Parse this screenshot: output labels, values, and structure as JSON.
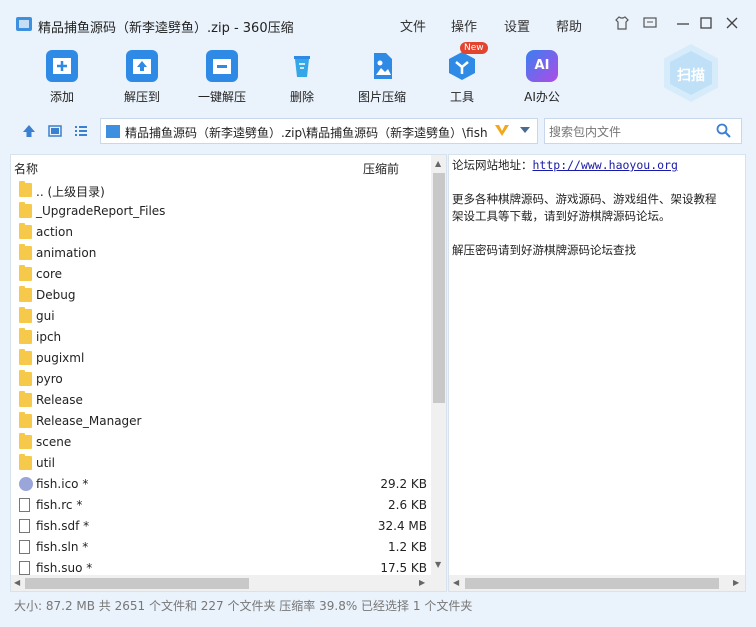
{
  "window": {
    "title": "精品捕鱼源码（新李逵劈鱼）.zip - 360压缩",
    "menu": [
      "文件",
      "操作",
      "设置",
      "帮助"
    ]
  },
  "toolbar": {
    "tools": [
      {
        "label": "添加",
        "icon": "add-icon"
      },
      {
        "label": "解压到",
        "icon": "extract-to-icon"
      },
      {
        "label": "一键解压",
        "icon": "one-click-extract-icon"
      },
      {
        "label": "删除",
        "icon": "delete-icon"
      },
      {
        "label": "图片压缩",
        "icon": "image-compress-icon"
      },
      {
        "label": "工具",
        "icon": "tools-icon"
      },
      {
        "label": "AI办公",
        "icon": "ai-office-icon"
      }
    ],
    "new_badge": "New",
    "scan_label": "扫描",
    "ai_text": "AI"
  },
  "address": {
    "path": "精品捕鱼源码（新李逵劈鱼）.zip\\精品捕鱼源码（新李逵劈鱼）\\fish",
    "search_placeholder": "搜索包内文件"
  },
  "list": {
    "col_name": "名称",
    "col_size": "压缩前",
    "rows": [
      {
        "name": ".. (上级目录)",
        "size": "",
        "type": "folder"
      },
      {
        "name": "_UpgradeReport_Files",
        "size": "",
        "type": "folder"
      },
      {
        "name": "action",
        "size": "",
        "type": "folder"
      },
      {
        "name": "animation",
        "size": "",
        "type": "folder"
      },
      {
        "name": "core",
        "size": "",
        "type": "folder"
      },
      {
        "name": "Debug",
        "size": "",
        "type": "folder"
      },
      {
        "name": "gui",
        "size": "",
        "type": "folder"
      },
      {
        "name": "ipch",
        "size": "",
        "type": "folder"
      },
      {
        "name": "pugixml",
        "size": "",
        "type": "folder"
      },
      {
        "name": "pyro",
        "size": "",
        "type": "folder"
      },
      {
        "name": "Release",
        "size": "",
        "type": "folder"
      },
      {
        "name": "Release_Manager",
        "size": "",
        "type": "folder"
      },
      {
        "name": "scene",
        "size": "",
        "type": "folder"
      },
      {
        "name": "util",
        "size": "",
        "type": "folder"
      },
      {
        "name": "fish.ico *",
        "size": "29.2 KB",
        "type": "ico"
      },
      {
        "name": "fish.rc *",
        "size": "2.6 KB",
        "type": "file"
      },
      {
        "name": "fish.sdf *",
        "size": "32.4 MB",
        "type": "file"
      },
      {
        "name": "fish.sln *",
        "size": "1.2 KB",
        "type": "file"
      },
      {
        "name": "fish.suo *",
        "size": "17.5 KB",
        "type": "file"
      }
    ]
  },
  "comment": {
    "line1_prefix": "论坛网站地址：",
    "line1_link": "http://www.haoyou.org",
    "line2": "更多各种棋牌源码、游戏源码、游戏组件、架设教程",
    "line3": "架设工具等下载，请到好游棋牌源码论坛。",
    "line4": "解压密码请到好游棋牌源码论坛查找"
  },
  "status": "大小: 87.2 MB 共 2651 个文件和 227 个文件夹 压缩率 39.8% 已经选择 1 个文件夹"
}
